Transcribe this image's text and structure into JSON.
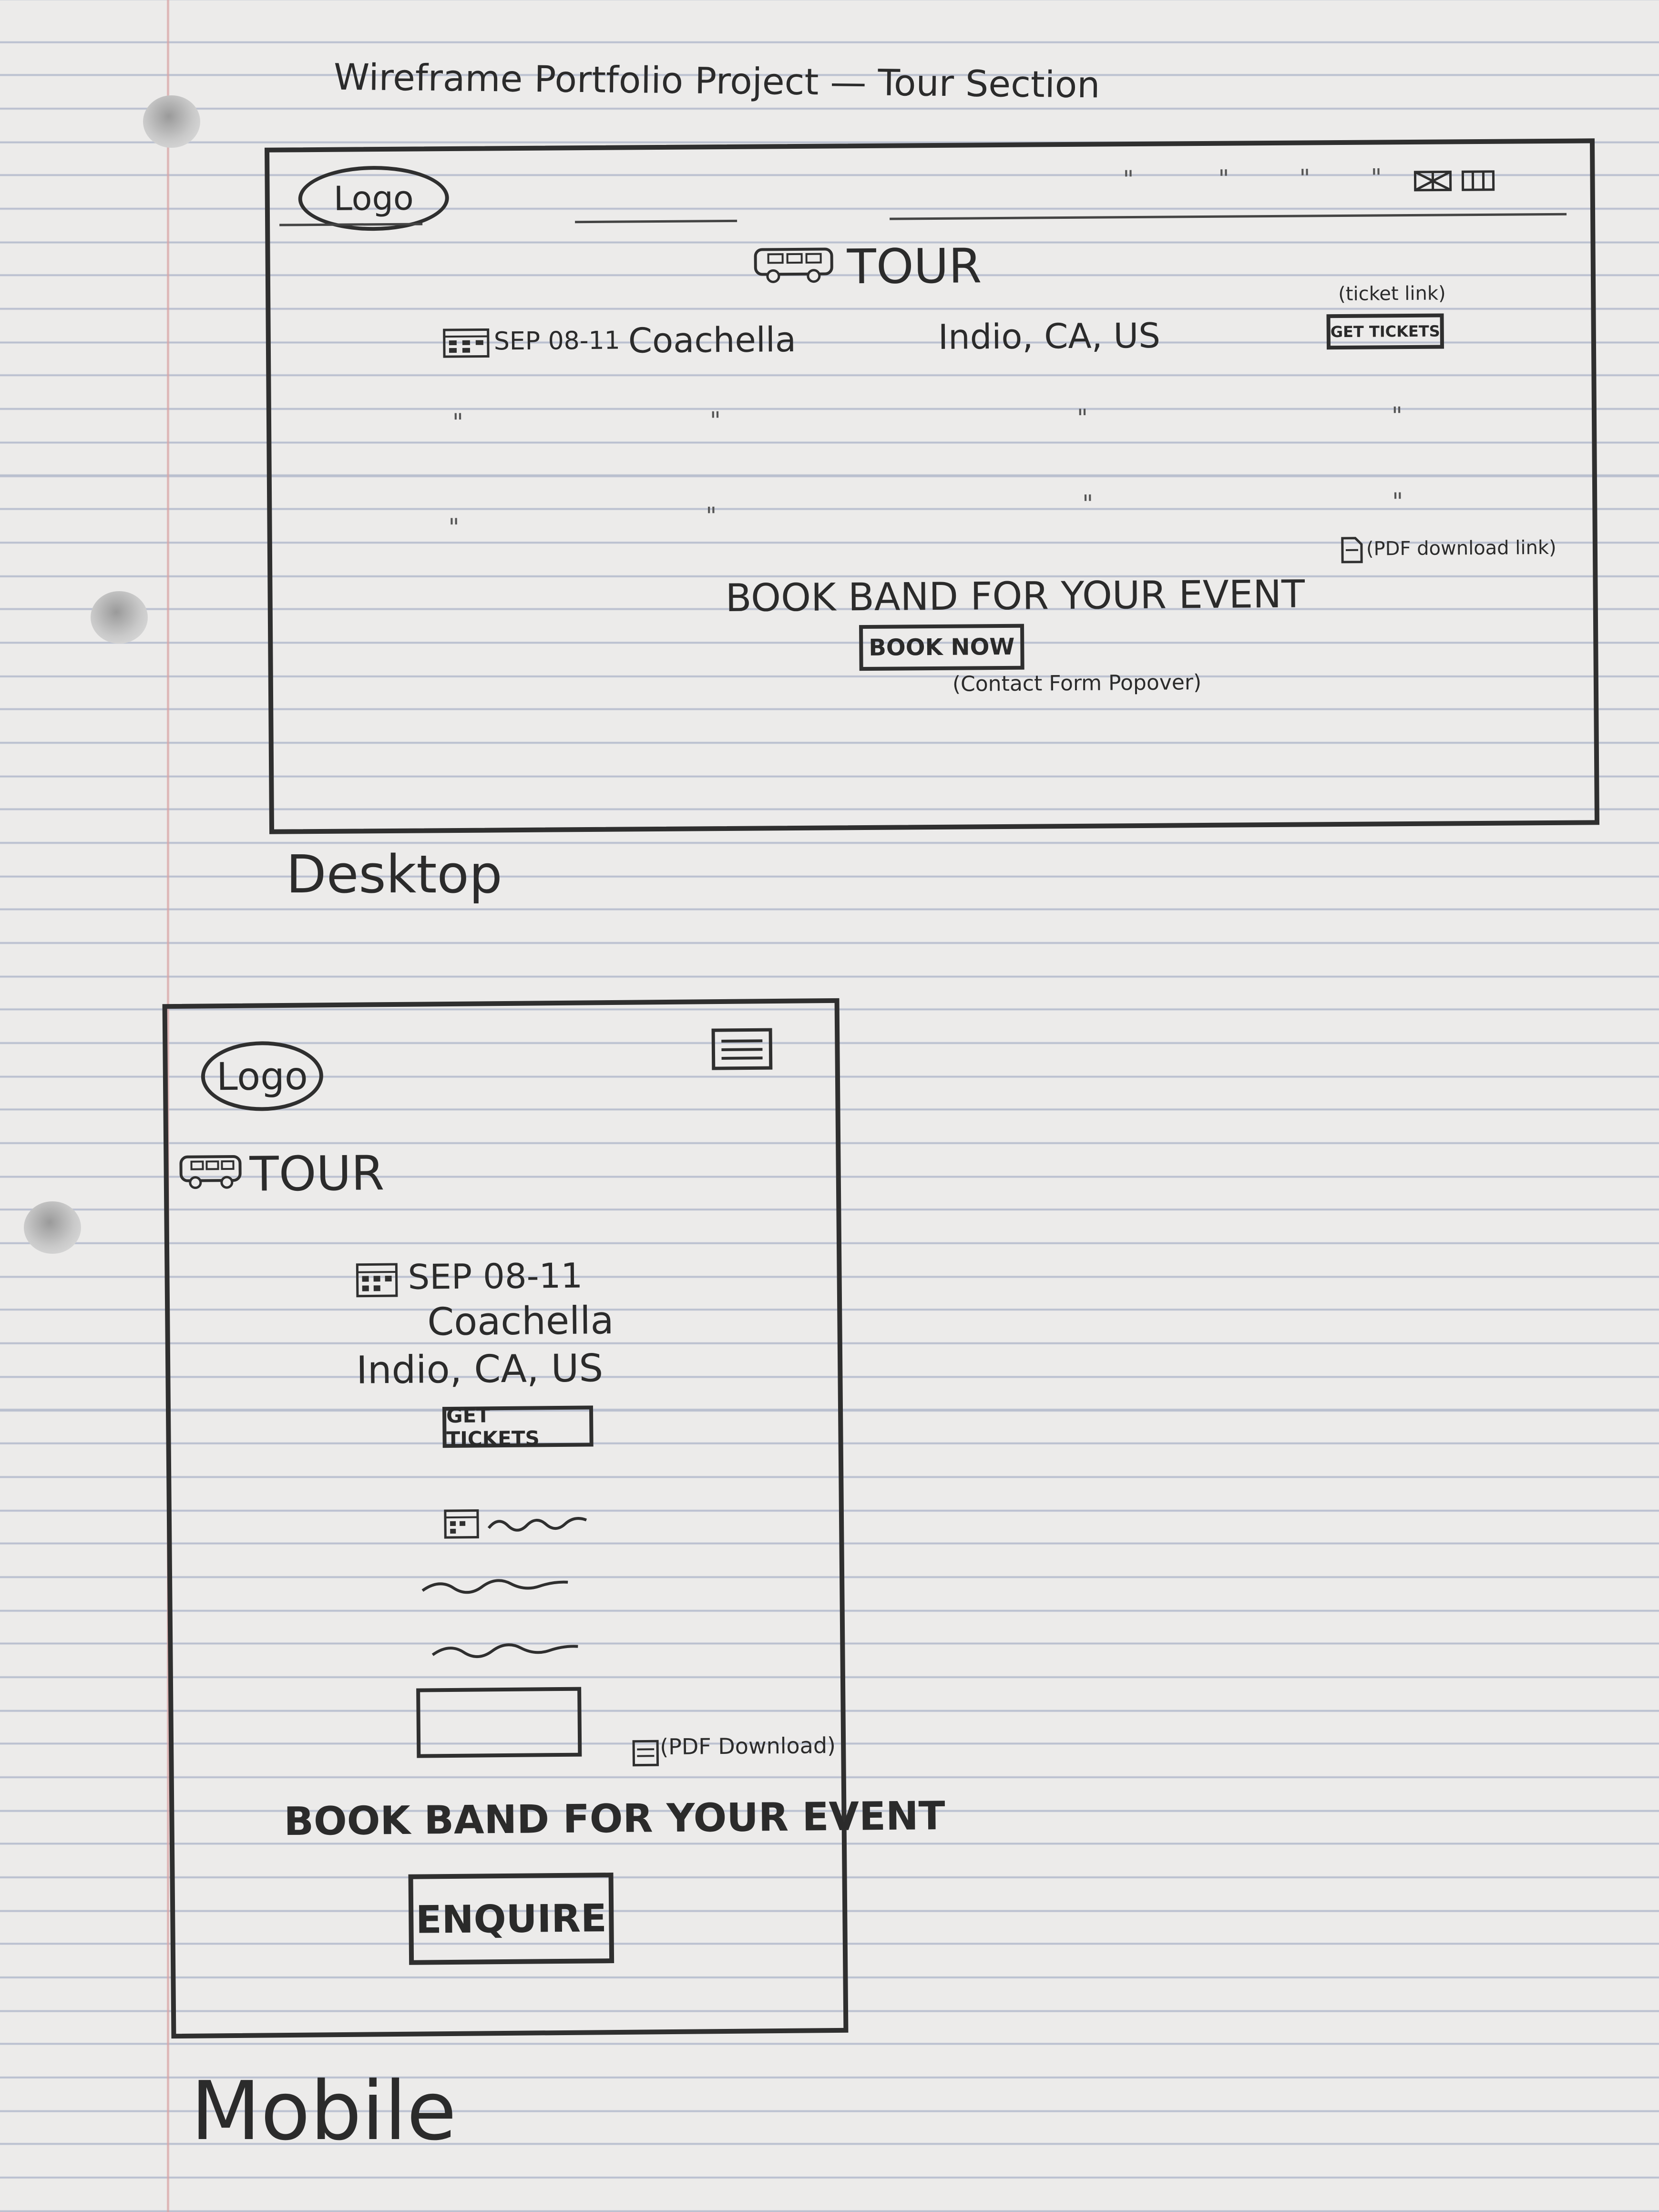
{
  "title": "Wireframe Portfolio Project — Tour Section",
  "desktop": {
    "label": "Desktop",
    "logo": "Logo",
    "section_title": "TOUR",
    "event": {
      "date": "SEP 08-11",
      "name": "Coachella",
      "location": "Indio, CA, US"
    },
    "ticket_note": "(ticket link)",
    "ticket_button": "GET TICKETS",
    "pdf_note": "(PDF download link)",
    "book_heading": "BOOK BAND FOR YOUR EVENT",
    "book_button": "BOOK NOW",
    "book_note": "(Contact Form Popover)",
    "ditto": "\""
  },
  "mobile": {
    "label": "Mobile",
    "logo": "Logo",
    "section_title": "TOUR",
    "event": {
      "date": "SEP 08-11",
      "name": "Coachella",
      "location": "Indio, CA, US"
    },
    "ticket_button": "GET TICKETS",
    "pdf_note": "(PDF Download)",
    "book_heading": "BOOK BAND FOR YOUR EVENT",
    "book_button": "ENQUIRE"
  },
  "icons": [
    "bus-icon",
    "calendar-icon",
    "flag-icon",
    "menu-icon",
    "pdf-icon",
    "squiggle"
  ]
}
